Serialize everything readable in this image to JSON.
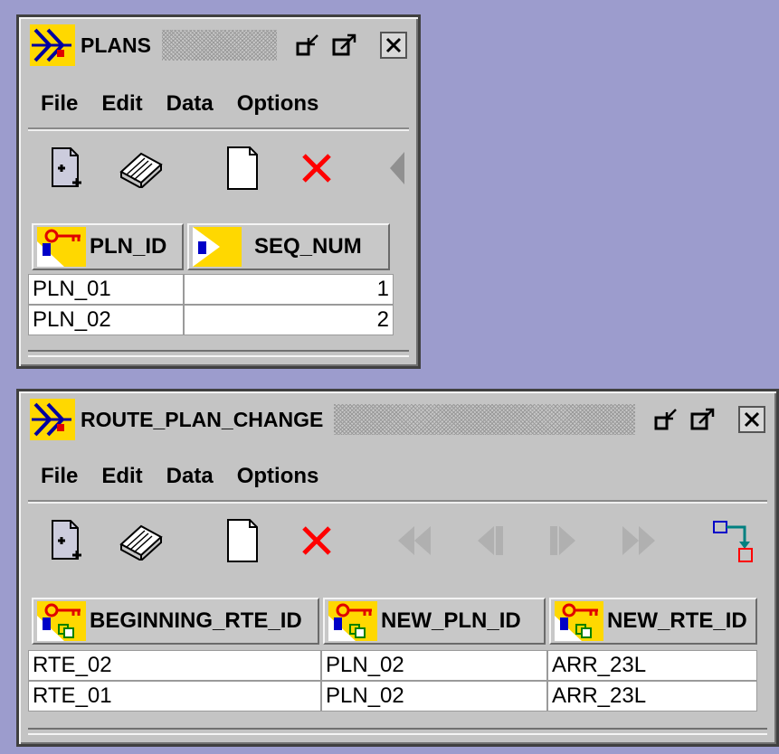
{
  "plans": {
    "title": "PLANS",
    "menu": [
      "File",
      "Edit",
      "Data",
      "Options"
    ],
    "toolbar": {
      "new_record": "new-record-icon",
      "save": "save-eraser-icon",
      "blank": "blank-page-icon",
      "delete": "delete-x-icon",
      "scroll": "scroll-left-arrow-icon"
    },
    "columns": [
      {
        "label": "PLN_ID",
        "icon": "primary-key-icon"
      },
      {
        "label": "SEQ_NUM",
        "icon": "column-icon"
      }
    ],
    "rows": [
      [
        "PLN_01",
        "1"
      ],
      [
        "PLN_02",
        "2"
      ]
    ]
  },
  "route_plan_change": {
    "title": "ROUTE_PLAN_CHANGE",
    "menu": [
      "File",
      "Edit",
      "Data",
      "Options"
    ],
    "toolbar": {
      "new_record": "new-record-icon",
      "save": "save-eraser-icon",
      "blank": "blank-page-icon",
      "delete": "delete-x-icon",
      "first": "first-record-icon",
      "prev": "previous-record-icon",
      "next": "next-record-icon",
      "last": "last-record-icon",
      "relate": "relationship-icon"
    },
    "columns": [
      {
        "label": "BEGINNING_RTE_ID",
        "icon": "foreign-key-icon"
      },
      {
        "label": "NEW_PLN_ID",
        "icon": "foreign-key-icon"
      },
      {
        "label": "NEW_RTE_ID",
        "icon": "foreign-key-icon"
      }
    ],
    "rows": [
      [
        "RTE_02",
        "PLN_02",
        "ARR_23L"
      ],
      [
        "RTE_01",
        "PLN_02",
        "ARR_23L"
      ]
    ]
  },
  "colors": {
    "desktop": "#9c9ccd",
    "window": "#c4c4c4",
    "delete_red": "#ff0000",
    "nav_disabled": "#b0b0b0",
    "icon_yellow": "#ffd800",
    "icon_blue": "#0000c8"
  }
}
